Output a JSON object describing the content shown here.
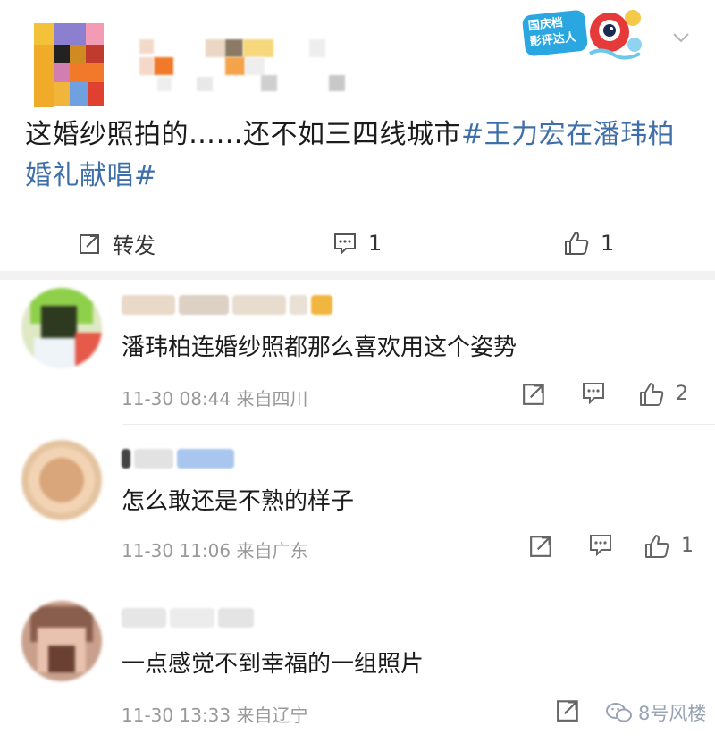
{
  "post": {
    "text_plain": "这婚纱照拍的……还不如三四线城市",
    "hashtag_part1": "#王力宏在潘玮柏",
    "hashtag_part2": "婚礼献唱#",
    "badge_text_line1": "国庆档",
    "badge_text_line2": "影评达人",
    "actions": {
      "repost_label": "转发",
      "comment_count": "1",
      "like_count": "1"
    }
  },
  "comments": [
    {
      "text": "潘玮柏连婚纱照都那么喜欢用这个姿势",
      "time": "11-30 08:44",
      "location": "来自四川",
      "like_count": "2"
    },
    {
      "text": "怎么敢还是不熟的样子",
      "time": "11-30 11:06",
      "location": "来自广东",
      "like_count": "1"
    },
    {
      "text": "一点感觉不到幸福的一组照片",
      "time": "11-30 13:33",
      "location": "来自辽宁",
      "like_count": ""
    }
  ],
  "watermark": "8号风楼",
  "colors": {
    "hashtag": "#3f6fa8",
    "meta_gray": "#999999",
    "divider": "#ececec"
  },
  "icons": [
    "repost-icon",
    "comment-icon",
    "like-icon",
    "chevron-down-icon",
    "wechat-icon"
  ]
}
